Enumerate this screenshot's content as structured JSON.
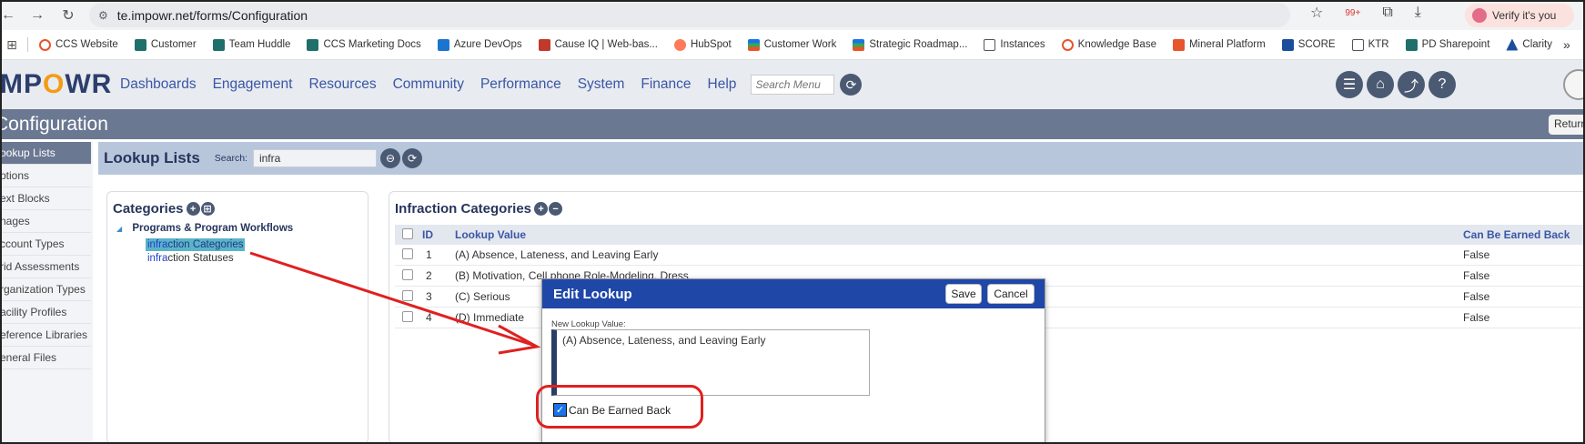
{
  "browser": {
    "url": "te.impowr.net/forms/Configuration",
    "verify_label": "Verify it's you",
    "badge": "99+",
    "bookmarks": [
      "CCS Website",
      "Customer",
      "Team Huddle",
      "CCS Marketing Docs",
      "Azure DevOps",
      "Cause IQ | Web-bas...",
      "HubSpot",
      "Customer Work",
      "Strategic Roadmap...",
      "Instances",
      "Knowledge Base",
      "Mineral Platform",
      "SCORE",
      "KTR",
      "PD Sharepoint",
      "Clarity"
    ]
  },
  "app": {
    "logo": "MPOWR",
    "menu": [
      "Dashboards",
      "Engagement",
      "Resources",
      "Community",
      "Performance",
      "System",
      "Finance",
      "Help"
    ],
    "search_menu_placeholder": "Search Menu",
    "page_title": "Configuration",
    "return_label": "Return"
  },
  "sidebar": {
    "items": [
      "ookup Lists",
      "ptions",
      "ext Blocks",
      "nages",
      "ccount Types",
      "rid Assessments",
      "rganization Types",
      "acility Profiles",
      "eference Libraries",
      "eneral Files"
    ]
  },
  "lookup": {
    "title": "Lookup Lists",
    "search_label": "Search:",
    "search_value": "infra"
  },
  "categories": {
    "title": "Categories",
    "group": "Programs & Program Workflows",
    "items": [
      {
        "highlight": "infra",
        "rest": "ction Categories"
      },
      {
        "highlight": "infra",
        "rest": "ction Statuses"
      }
    ]
  },
  "infraction_table": {
    "title": "Infraction Categories",
    "columns": {
      "id": "ID",
      "value": "Lookup Value",
      "earn": "Can Be Earned Back"
    },
    "rows": [
      {
        "id": "1",
        "value": "(A) Absence, Lateness, and Leaving Early",
        "earn": "False"
      },
      {
        "id": "2",
        "value": "(B) Motivation, Cell phone Role-Modeling, Dress",
        "earn": "False"
      },
      {
        "id": "3",
        "value": "(C) Serious",
        "earn": "False"
      },
      {
        "id": "4",
        "value": "(D) Immediate",
        "earn": "False"
      }
    ]
  },
  "dialog": {
    "title": "Edit Lookup",
    "save": "Save",
    "cancel": "Cancel",
    "field_label": "New Lookup Value:",
    "field_value": "(A) Absence, Lateness, and Leaving Early",
    "checkbox_label": "Can Be Earned Back",
    "checkbox_checked": true
  }
}
